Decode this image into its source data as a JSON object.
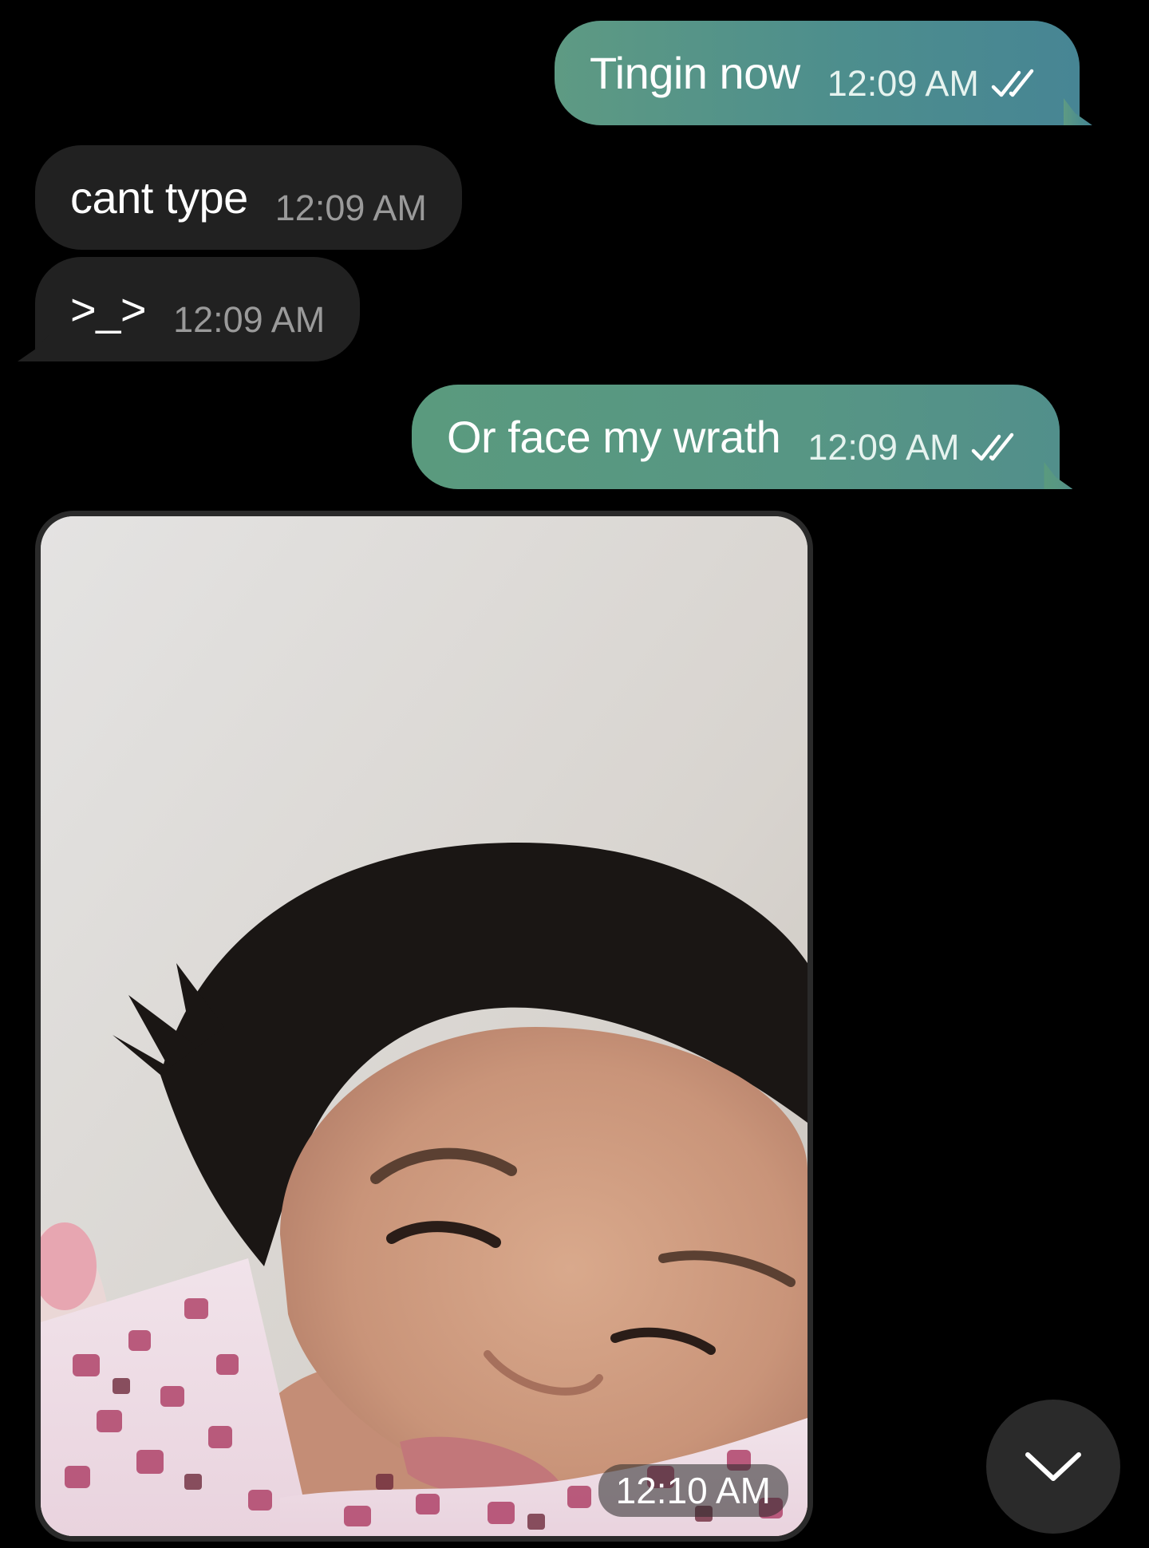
{
  "messages": [
    {
      "direction": "outgoing",
      "text": "Tingin now",
      "time": "12:09 AM",
      "status": "read-double-check"
    },
    {
      "direction": "incoming",
      "text": "cant type",
      "time": "12:09 AM"
    },
    {
      "direction": "incoming",
      "text": ">_>",
      "time": "12:09 AM"
    },
    {
      "direction": "outgoing",
      "text": "Or face my wrath",
      "time": "12:09 AM",
      "status": "read-double-check"
    },
    {
      "direction": "incoming",
      "type": "photo",
      "time": "12:10 AM",
      "description_icon": "photo-selfie"
    }
  ],
  "scroll_button": {
    "icon": "chevron-down-icon"
  },
  "colors": {
    "background": "#000000",
    "outgoing_bubble": "#4e8f8a",
    "incoming_bubble": "#212121",
    "incoming_time": "#9a9a9a"
  }
}
